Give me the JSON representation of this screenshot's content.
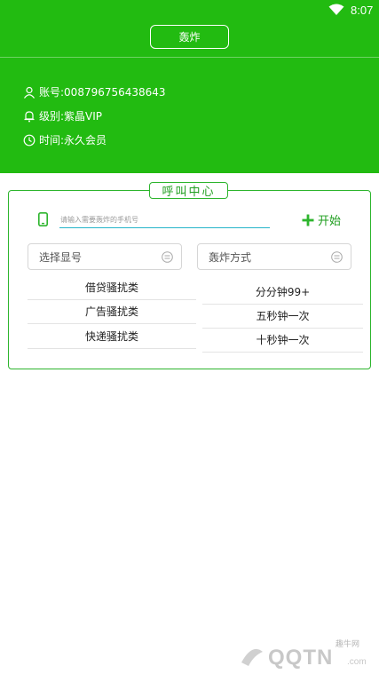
{
  "status_bar": {
    "time": "8:07",
    "wifi_icon": "wifi-icon"
  },
  "header": {
    "top_button_label": "轰炸",
    "account_label": "账号:008796756438643",
    "level_label": "级别:紫晶VIP",
    "time_label": "时间:永久会员",
    "background_color": "#22bb11",
    "icons": [
      "user-icon",
      "bell-icon",
      "clock-icon"
    ]
  },
  "call_center": {
    "title": "呼叫中心",
    "phone_placeholder": "请输入需要轰炸的手机号",
    "phone_value": "",
    "start_label": "开始",
    "select_number_placeholder": "选择显号",
    "select_mode_placeholder": "轰炸方式",
    "number_options": [
      "借贷骚扰类",
      "广告骚扰类",
      "快递骚扰类"
    ],
    "mode_options": [
      "分分钟99+",
      "五秒钟一次",
      "十秒钟一次"
    ],
    "accent_color": "#2db52d"
  },
  "watermark": {
    "small": "趣牛网",
    "big": "QQTN",
    "suffix": ".com"
  }
}
